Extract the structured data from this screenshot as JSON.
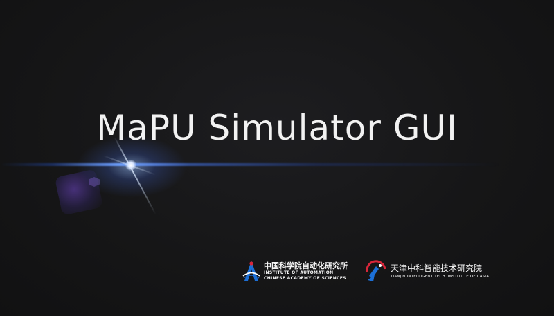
{
  "app": {
    "title": "MaPU Simulator GUI"
  },
  "logos": {
    "casia": {
      "icon": "casia-emblem-icon",
      "name_cn": "中国科学院自动化研究所",
      "name_en_line1": "INSTITUTE OF AUTOMATION",
      "name_en_line2": "CHINESE ACADEMY OF SCIENCES"
    },
    "tianjin": {
      "icon": "tianjin-casia-emblem-icon",
      "name_cn": "天津中科智能技术研究院",
      "name_en": "TIANJIN INTELLIGENT TECH. INSTITUTE OF CASIA"
    }
  },
  "colors": {
    "background": "#161617",
    "title_text": "#f2f2f2",
    "flare_blue": "#6ea0ff",
    "casia_blue": "#1c6fd6",
    "tianjin_red": "#d8263a"
  }
}
